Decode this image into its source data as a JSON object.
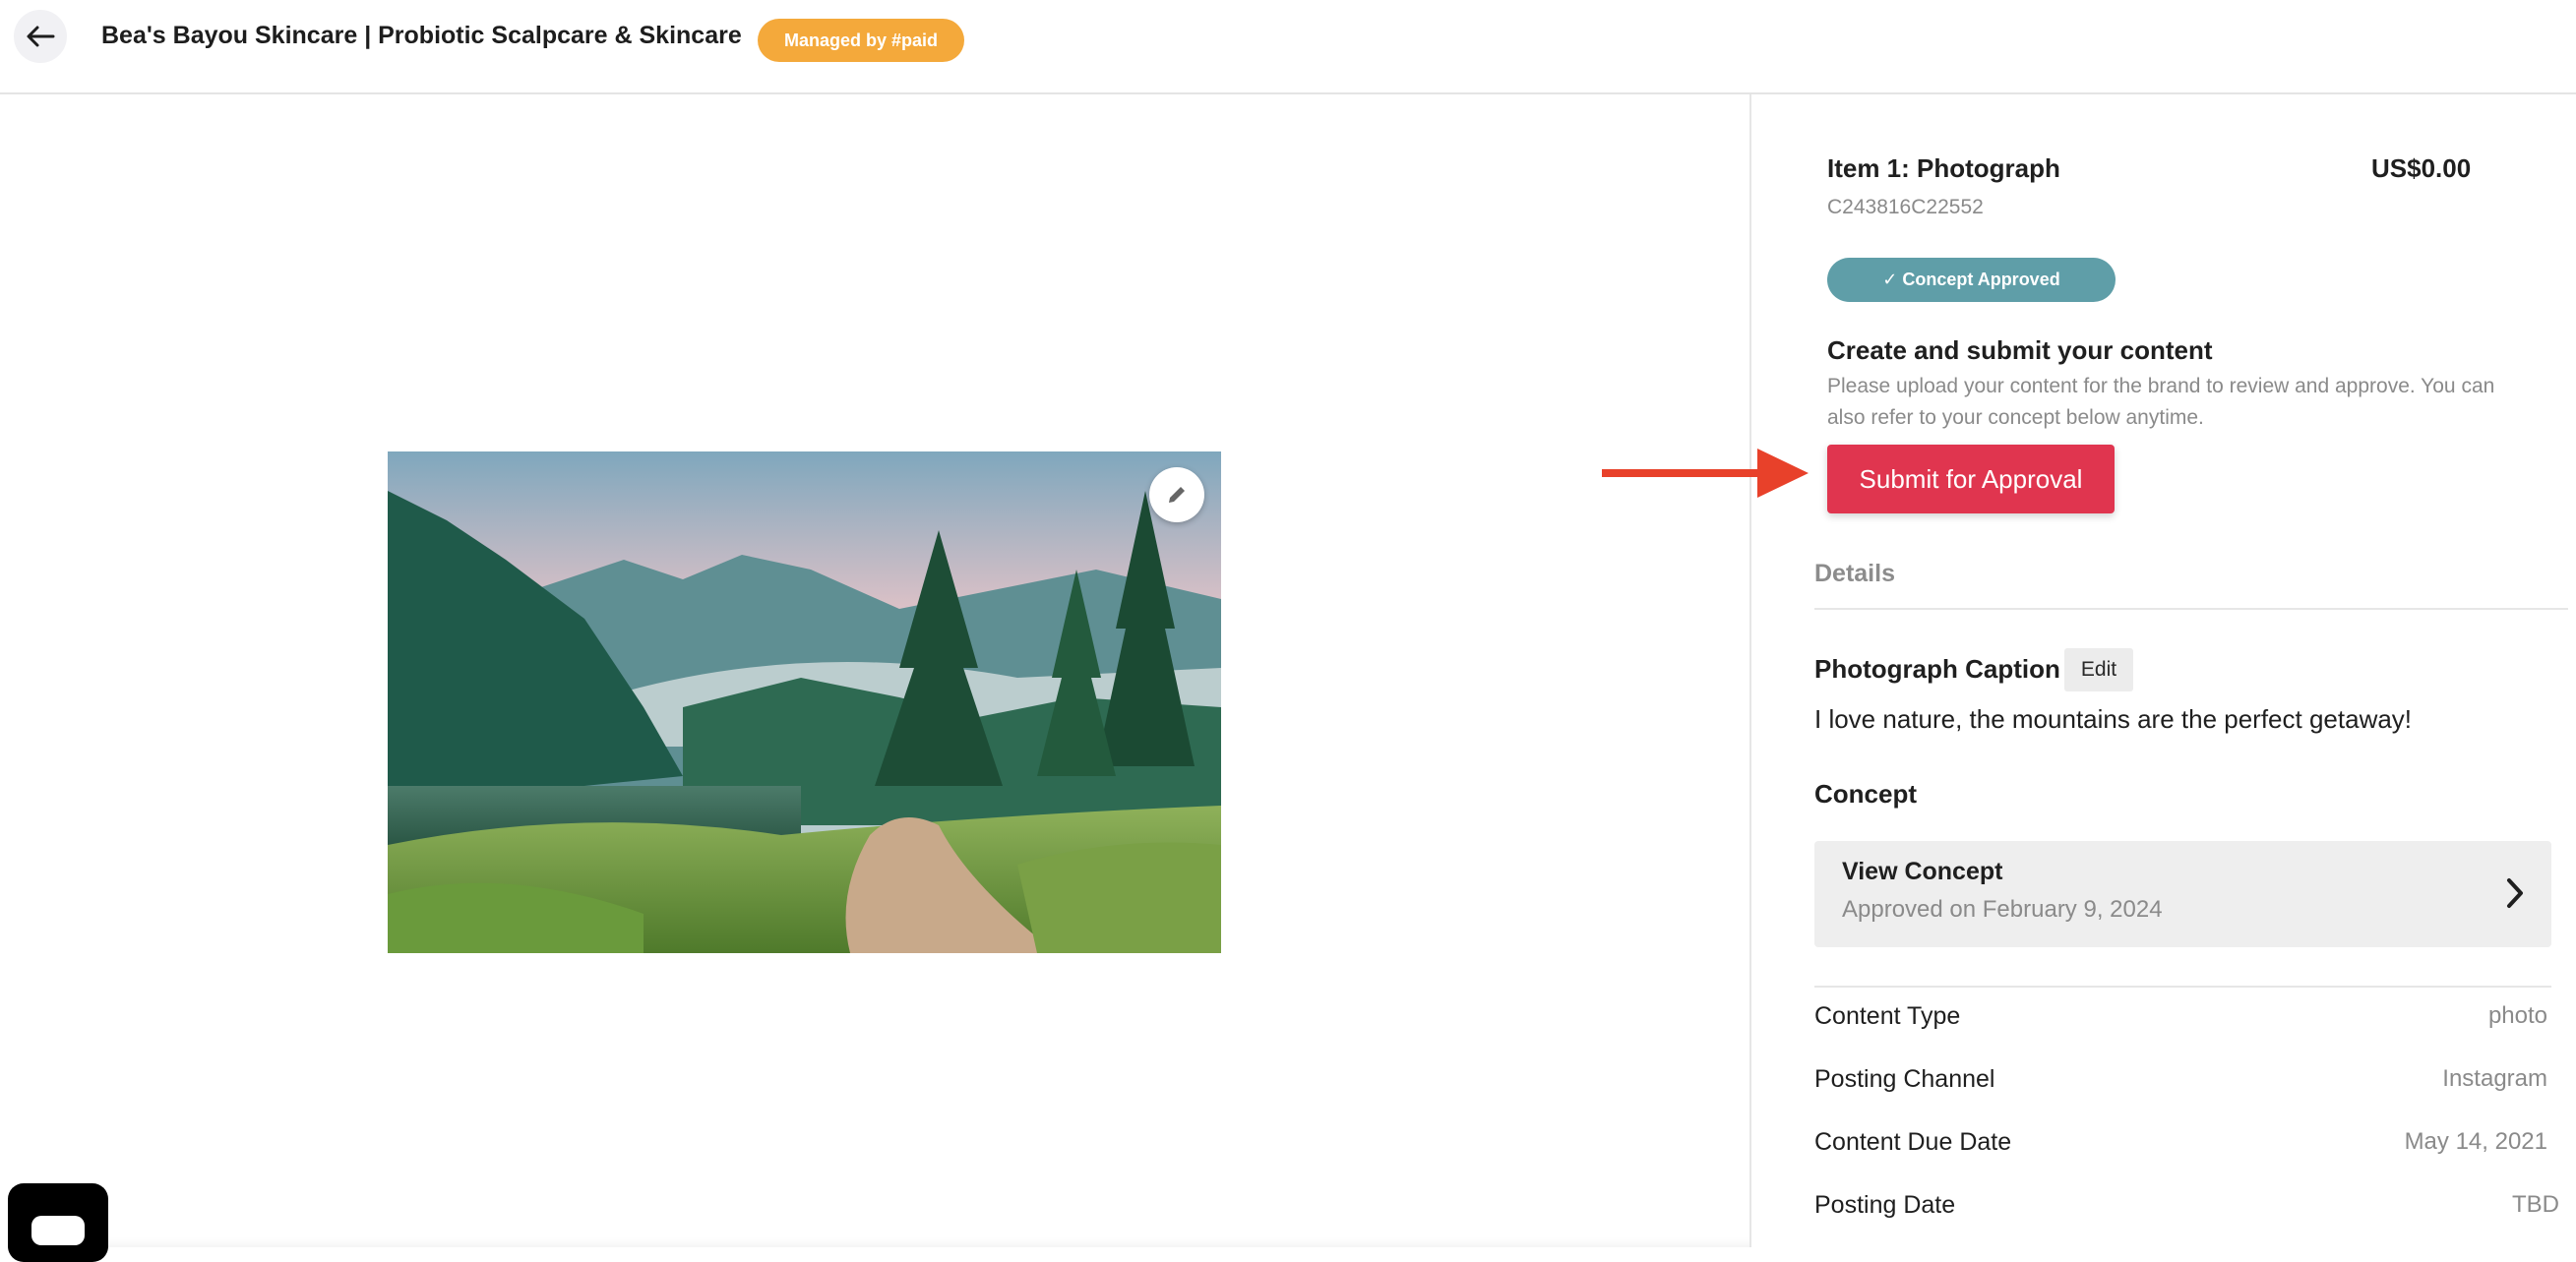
{
  "header": {
    "title": "Bea's Bayou Skincare | Probiotic Scalpcare & Skincare",
    "badge": "Managed by #paid"
  },
  "item": {
    "title": "Item 1: Photograph",
    "price": "US$0.00",
    "code": "C243816C22552",
    "status_badge": "✓ Concept Approved"
  },
  "submit_section": {
    "title": "Create and submit your content",
    "description": "Please upload your content for the brand to review and approve. You can also refer to your concept below anytime.",
    "button_label": "Submit for Approval"
  },
  "details": {
    "tab_label": "Details",
    "caption_label": "Photograph Caption",
    "caption_edit_label": "Edit",
    "caption_text": "I love nature, the mountains are the perfect getaway!",
    "concept_label": "Concept",
    "view_concept_title": "View Concept",
    "view_concept_sub": "Approved on February 9, 2024",
    "rows": [
      {
        "label": "Content Type",
        "value": "photo"
      },
      {
        "label": "Posting Channel",
        "value": "Instagram"
      },
      {
        "label": "Content Due Date",
        "value": "May 14, 2021"
      },
      {
        "label": "Posting Date",
        "value": "TBD"
      }
    ]
  },
  "colors": {
    "accent_red": "#e0354f",
    "badge_orange": "#f4a93b",
    "badge_teal": "#5f9ea8",
    "annotation_arrow": "#e8412a"
  },
  "icons": {
    "back": "arrow-left-icon",
    "edit_photo": "pencil-icon",
    "chevron": "chevron-right-icon",
    "chat": "chat-widget-icon"
  }
}
